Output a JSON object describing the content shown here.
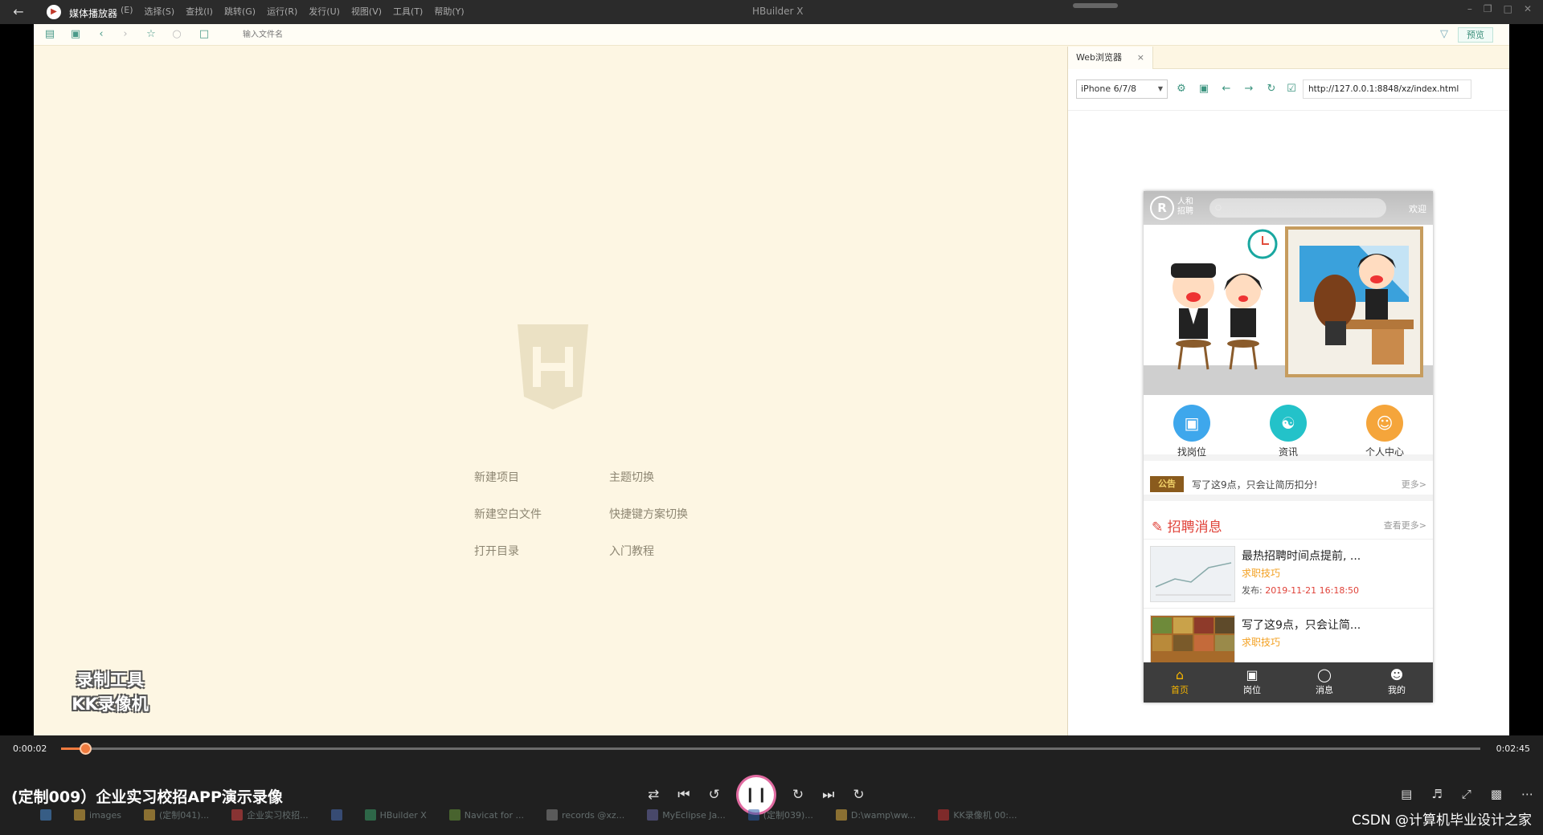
{
  "titlebar": {
    "player_name": "媒体播放器",
    "menu": [
      "(E)",
      "选择(S)",
      "查找(I)",
      "跳转(G)",
      "运行(R)",
      "发行(U)",
      "视图(V)",
      "工具(T)",
      "帮助(Y)"
    ],
    "window_title": "HBuilder X"
  },
  "toolbar": {
    "file_input_placeholder": "输入文件名",
    "preview_label": "预览"
  },
  "editor": {
    "links": [
      "新建项目",
      "主题切换",
      "新建空白文件",
      "快捷键方案切换",
      "打开目录",
      "入门教程"
    ],
    "watermark_line1": "录制工具",
    "watermark_line2": "KK录像机"
  },
  "browser": {
    "tab_label": "Web浏览器",
    "device": "iPhone 6/7/8",
    "url": "http://127.0.0.1:8848/xz/index.html"
  },
  "phone": {
    "logo_text": "人和",
    "logo_subtext": "招聘",
    "welcome": "欢迎",
    "quick_icons": [
      {
        "label": "找岗位",
        "color": "#3ea7ec",
        "icon": "briefcase-icon"
      },
      {
        "label": "资讯",
        "color": "#23c2c9",
        "icon": "handshake-icon"
      },
      {
        "label": "个人中心",
        "color": "#f5a53b",
        "icon": "profile-icon"
      }
    ],
    "notice_tag": "公告",
    "notice_text": "写了这9点，只会让简历扣分!",
    "notice_more": "更多>",
    "section_title": "招聘消息",
    "section_more": "查看更多>",
    "jobs": [
      {
        "title": "最热招聘时间点提前, ...",
        "category": "求职技巧",
        "date_label": "发布:",
        "date": "2019-11-21 16:18:50"
      },
      {
        "title": "写了这9点，只会让简...",
        "category": "求职技巧"
      }
    ],
    "tabs": [
      {
        "label": "首页",
        "active": true,
        "icon": "home-icon"
      },
      {
        "label": "岗位",
        "active": false,
        "icon": "briefcase-icon"
      },
      {
        "label": "消息",
        "active": false,
        "icon": "message-icon"
      },
      {
        "label": "我的",
        "active": false,
        "icon": "user-icon"
      }
    ]
  },
  "player": {
    "time_current": "0:00:02",
    "time_total": "0:02:45",
    "progress_fraction": 0.012,
    "video_title": "(定制009）企业实习校招APP演示录像",
    "accent_color": "#f07b3f"
  },
  "taskbar": {
    "items": [
      "images",
      "(定制041)...",
      "企业实习校招...",
      "",
      "HBuilder X",
      "Navicat for ...",
      "records @xz...",
      "MyEclipse Ja...",
      "(定制039)...",
      "D:\\wamp\\ww...",
      "KK录像机 00:..."
    ]
  },
  "overlay": {
    "csdn": "CSDN @计算机毕业设计之家"
  }
}
